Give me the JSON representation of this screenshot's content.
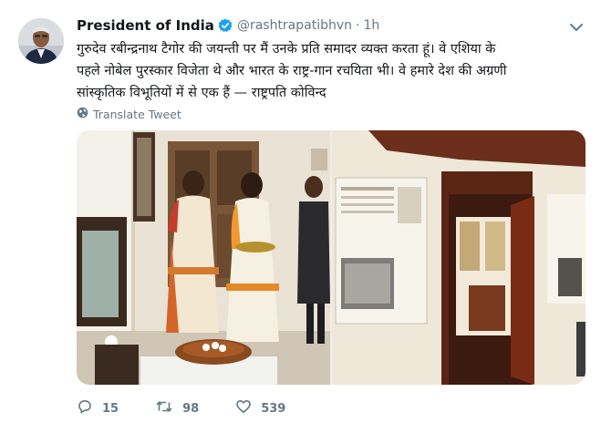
{
  "tweet": {
    "author_name": "President of India",
    "handle": "@rashtrapatibhvn",
    "separator": "·",
    "time": "1h",
    "text_lines": [
      "गुरुदेव रबीन्द्रनाथ टैगोर की जयन्ती पर मैं उनके प्रति समादर व्यक्त करता हूं। वे एशिया के",
      "पहले नोबेल पुरस्कार विजेता थे और भारत के राष्ट्र-गान रचयिता भी। वे हमारे देश की अग्रणी",
      "सांस्कृतिक विभूतियों में से एक हैं — राष्ट्रपति कोविन्द"
    ],
    "translate_label": "Translate Tweet"
  },
  "actions": {
    "reply_count": "15",
    "retweet_count": "98",
    "like_count": "539"
  },
  "icons": {
    "verified": "verified-badge-icon",
    "caret": "chevron-down-icon",
    "translate": "globe-icon",
    "reply": "reply-icon",
    "retweet": "retweet-icon",
    "like": "heart-icon"
  },
  "colors": {
    "accent": "#1da1f2",
    "text": "#14171a",
    "muted": "#657786"
  }
}
